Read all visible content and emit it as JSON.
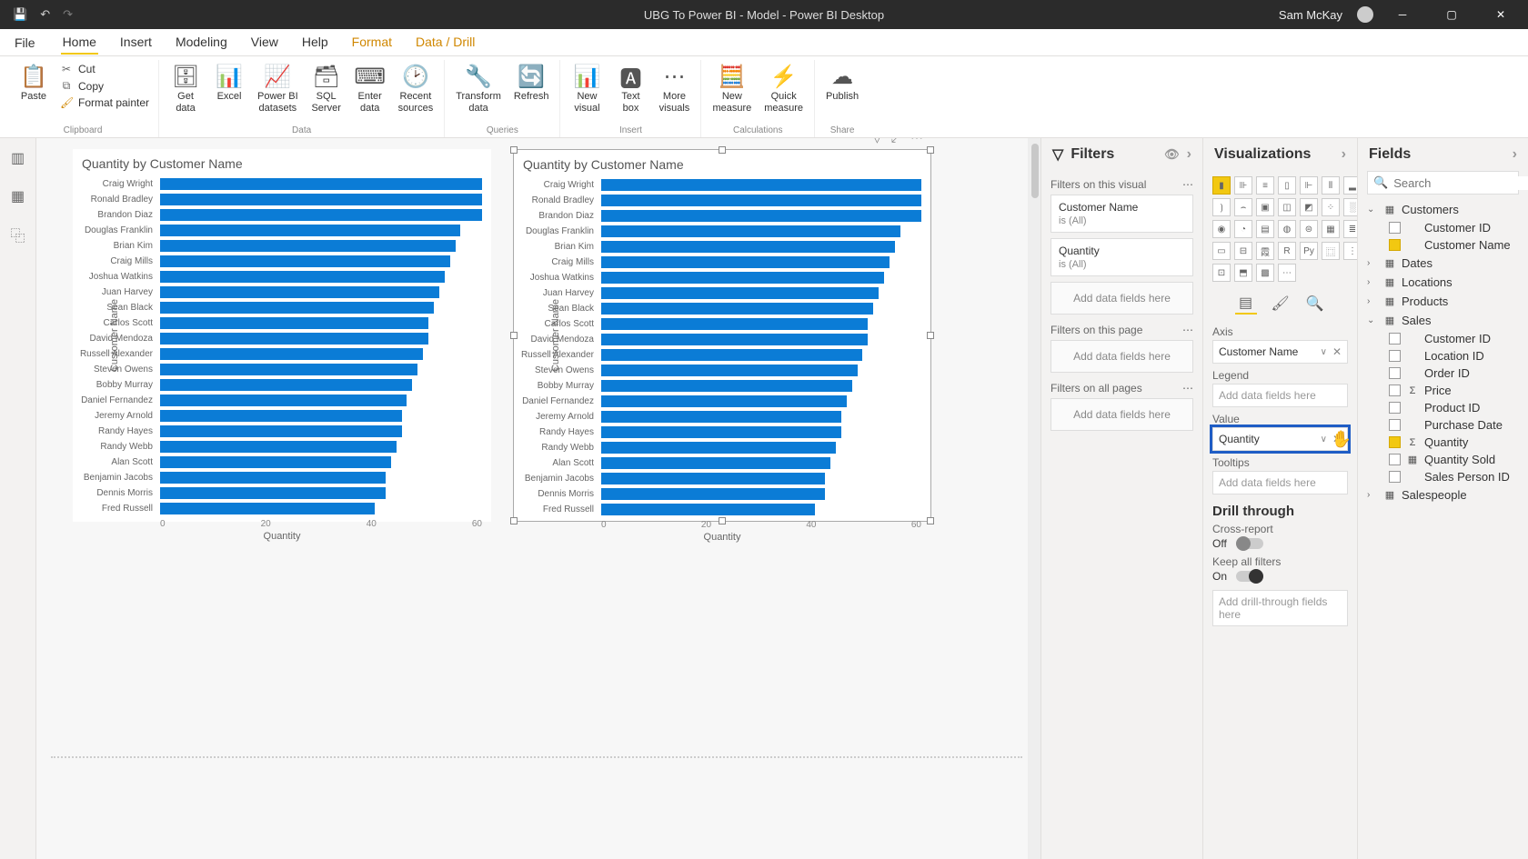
{
  "app": {
    "title": "UBG To Power BI - Model - Power BI Desktop",
    "user": "Sam McKay"
  },
  "menu": {
    "file": "File",
    "tabs": [
      "Home",
      "Insert",
      "Modeling",
      "View",
      "Help",
      "Format",
      "Data / Drill"
    ],
    "active": 0,
    "highlighted": [
      5,
      6
    ]
  },
  "ribbon": {
    "clipboard": {
      "paste": "Paste",
      "cut": "Cut",
      "copy": "Copy",
      "format_painter": "Format painter",
      "label": "Clipboard"
    },
    "data": {
      "get_data": "Get\ndata",
      "excel": "Excel",
      "pbi_datasets": "Power BI\ndatasets",
      "sql_server": "SQL\nServer",
      "enter_data": "Enter\ndata",
      "recent_sources": "Recent\nsources",
      "label": "Data"
    },
    "queries": {
      "transform": "Transform\ndata",
      "refresh": "Refresh",
      "label": "Queries"
    },
    "insert": {
      "new_visual": "New\nvisual",
      "text_box": "Text\nbox",
      "more_visuals": "More\nvisuals",
      "label": "Insert"
    },
    "calculations": {
      "new_measure": "New\nmeasure",
      "quick_measure": "Quick\nmeasure",
      "label": "Calculations"
    },
    "share": {
      "publish": "Publish",
      "label": "Share"
    }
  },
  "filters": {
    "title": "Filters",
    "on_visual": "Filters on this visual",
    "on_page": "Filters on this page",
    "on_all": "Filters on all pages",
    "add_fields": "Add data fields here",
    "items": [
      {
        "name": "Customer Name",
        "value": "is (All)"
      },
      {
        "name": "Quantity",
        "value": "is (All)"
      }
    ]
  },
  "viz": {
    "title": "Visualizations",
    "axis_label": "Axis",
    "axis_value": "Customer Name",
    "legend_label": "Legend",
    "value_label": "Value",
    "value_value": "Quantity",
    "tooltips_label": "Tooltips",
    "add_fields": "Add data fields here",
    "drill_through": "Drill through",
    "cross_report": "Cross-report",
    "off": "Off",
    "keep_filters": "Keep all filters",
    "on": "On",
    "add_drill": "Add drill-through fields here"
  },
  "fields": {
    "title": "Fields",
    "search_placeholder": "Search",
    "tables": [
      {
        "name": "Customers",
        "expanded": true,
        "items": [
          {
            "name": "Customer ID",
            "checked": false,
            "icon": ""
          },
          {
            "name": "Customer Name",
            "checked": true,
            "icon": ""
          }
        ]
      },
      {
        "name": "Dates",
        "expanded": false,
        "items": []
      },
      {
        "name": "Locations",
        "expanded": false,
        "items": []
      },
      {
        "name": "Products",
        "expanded": false,
        "items": []
      },
      {
        "name": "Sales",
        "expanded": true,
        "items": [
          {
            "name": "Customer ID",
            "checked": false,
            "icon": ""
          },
          {
            "name": "Location ID",
            "checked": false,
            "icon": ""
          },
          {
            "name": "Order ID",
            "checked": false,
            "icon": ""
          },
          {
            "name": "Price",
            "checked": false,
            "icon": "Σ"
          },
          {
            "name": "Product ID",
            "checked": false,
            "icon": ""
          },
          {
            "name": "Purchase Date",
            "checked": false,
            "icon": ""
          },
          {
            "name": "Quantity",
            "checked": true,
            "icon": "Σ"
          },
          {
            "name": "Quantity Sold",
            "checked": false,
            "icon": "▦"
          },
          {
            "name": "Sales Person ID",
            "checked": false,
            "icon": ""
          }
        ]
      },
      {
        "name": "Salespeople",
        "expanded": false,
        "items": []
      }
    ]
  },
  "chart_data": [
    {
      "type": "bar",
      "title": "Quantity by Customer Name",
      "xlabel": "Quantity",
      "ylabel": "Customer Name",
      "xlim": [
        0,
        60
      ],
      "ticks": [
        0,
        20,
        40,
        60
      ],
      "categories": [
        "Craig Wright",
        "Ronald Bradley",
        "Brandon Diaz",
        "Douglas Franklin",
        "Brian Kim",
        "Craig Mills",
        "Joshua Watkins",
        "Juan Harvey",
        "Sean Black",
        "Carlos Scott",
        "David Mendoza",
        "Russell Alexander",
        "Steven Owens",
        "Bobby Murray",
        "Daniel Fernandez",
        "Jeremy Arnold",
        "Randy Hayes",
        "Randy Webb",
        "Alan Scott",
        "Benjamin Jacobs",
        "Dennis Morris",
        "Fred Russell"
      ],
      "values": [
        60,
        60,
        60,
        56,
        55,
        54,
        53,
        52,
        51,
        50,
        50,
        49,
        48,
        47,
        46,
        45,
        45,
        44,
        43,
        42,
        42,
        40
      ]
    },
    {
      "type": "bar",
      "title": "Quantity by Customer Name",
      "xlabel": "Quantity",
      "ylabel": "Customer Name",
      "xlim": [
        0,
        60
      ],
      "ticks": [
        0,
        20,
        40,
        60
      ],
      "categories": [
        "Craig Wright",
        "Ronald Bradley",
        "Brandon Diaz",
        "Douglas Franklin",
        "Brian Kim",
        "Craig Mills",
        "Joshua Watkins",
        "Juan Harvey",
        "Sean Black",
        "Carlos Scott",
        "David Mendoza",
        "Russell Alexander",
        "Steven Owens",
        "Bobby Murray",
        "Daniel Fernandez",
        "Jeremy Arnold",
        "Randy Hayes",
        "Randy Webb",
        "Alan Scott",
        "Benjamin Jacobs",
        "Dennis Morris",
        "Fred Russell"
      ],
      "values": [
        60,
        60,
        60,
        56,
        55,
        54,
        53,
        52,
        51,
        50,
        50,
        49,
        48,
        47,
        46,
        45,
        45,
        44,
        43,
        42,
        42,
        40
      ]
    }
  ]
}
